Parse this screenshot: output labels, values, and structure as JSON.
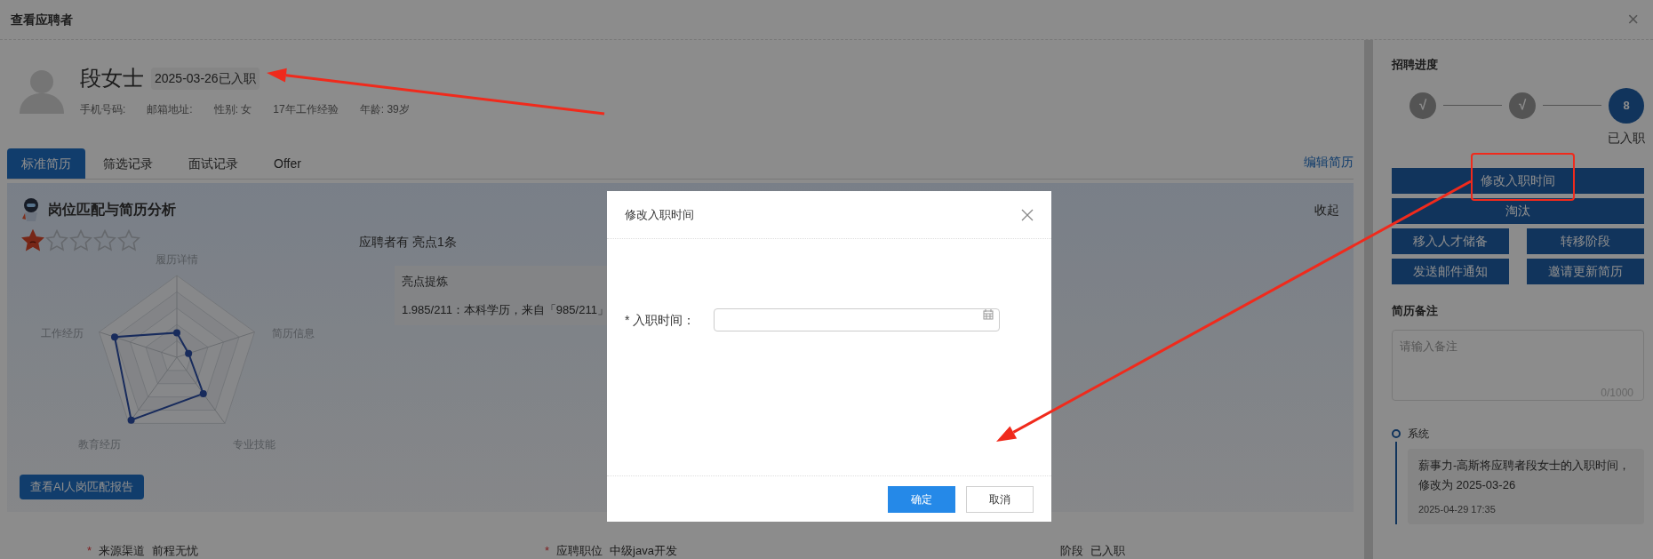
{
  "window": {
    "title": "查看应聘者",
    "close": "×"
  },
  "candidate": {
    "name": "段女士",
    "status_badge": "2025-03-26已入职",
    "details": [
      "手机号码:",
      "邮箱地址:",
      "性别: 女",
      "17年工作经验",
      "年龄: 39岁"
    ]
  },
  "tabs": [
    {
      "label": "标准简历",
      "selected": true
    },
    {
      "label": "筛选记录",
      "selected": false
    },
    {
      "label": "面试记录",
      "selected": false
    },
    {
      "label": "Offer",
      "selected": false
    }
  ],
  "edit_link": "编辑简历",
  "analysis": {
    "title": "岗位匹配与简历分析",
    "collapse": "收起",
    "stars": 1,
    "radar_axes": [
      "履历详情",
      "简历信息",
      "专业技能",
      "教育经历",
      "工作经历"
    ],
    "highlight_summary": "应聘者有 亮点1条",
    "highlight_box": {
      "title": "亮点提炼",
      "items": [
        "1.985/211：本科学历，来自「985/211」"
      ]
    },
    "report_button": "查看AI人岗匹配报告"
  },
  "fields": [
    {
      "required_mark": "*",
      "label": "来源渠道",
      "value": "前程无忧"
    },
    {
      "required_mark": "*",
      "label": "应聘职位",
      "value": "中级java开发"
    },
    {
      "label": "阶段",
      "value": "已入职"
    }
  ],
  "progress": {
    "title": "招聘进度",
    "steps": [
      {
        "kind": "done",
        "mark": "√"
      },
      {
        "kind": "done",
        "mark": "√"
      },
      {
        "kind": "current",
        "mark": "8",
        "label": "已入职"
      }
    ]
  },
  "actions": [
    "修改入职时间",
    "淘汰",
    "移入人才储备",
    "转移阶段",
    "发送邮件通知",
    "邀请更新简历"
  ],
  "notes": {
    "title": "简历备注",
    "placeholder": "请输入备注",
    "counter": "0/1000"
  },
  "timeline": [
    {
      "author": "系统",
      "text": "薪事力-高斯将应聘者段女士的入职时间，修改为 2025-03-26",
      "time": "2025-04-29 17:35"
    }
  ],
  "dialog": {
    "title": "修改入职时间",
    "field": {
      "required_mark": "*",
      "label": "入职时间："
    },
    "buttons": [
      {
        "label": "确定",
        "kind": "primary"
      },
      {
        "label": "取消",
        "kind": "default"
      }
    ]
  }
}
